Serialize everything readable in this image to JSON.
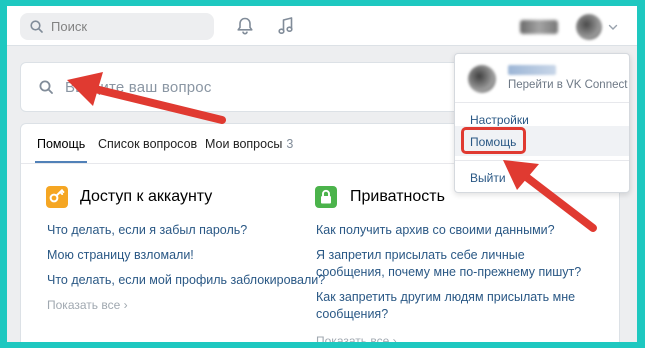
{
  "header": {
    "search_placeholder": "Поиск",
    "icons": [
      "search-icon",
      "bell-icon",
      "music-icon",
      "chevron-down-icon"
    ]
  },
  "help": {
    "ask_placeholder": "Введите ваш вопрос",
    "tabs": [
      {
        "label": "Помощь",
        "active": true
      },
      {
        "label": "Список вопросов"
      },
      {
        "label": "Мои вопросы",
        "count": "3"
      }
    ],
    "sections": [
      {
        "title": "Доступ к аккаунту",
        "icon": "key-icon",
        "color": "#f5a623",
        "questions": [
          "Что делать, если я забыл пароль?",
          "Мою страницу взломали!",
          "Что делать, если мой профиль заблокировали?"
        ],
        "more": "Показать все"
      },
      {
        "title": "Приватность",
        "icon": "lock-icon",
        "color": "#4bb34b",
        "questions": [
          "Как получить архив со своими данными?",
          "Я запретил присылать себе личные сообщения, почему мне по-прежнему пишут?",
          "Как запретить другим людям присылать мне сообщения?"
        ],
        "more": "Показать все"
      }
    ]
  },
  "dropdown": {
    "connect_label": "Перейти в VK Connect",
    "items": [
      "Настройки",
      "Помощь",
      "Выйти"
    ]
  },
  "colors": {
    "frame": "#1ec8c0",
    "link": "#2a5885",
    "annotation": "#e03a31"
  }
}
